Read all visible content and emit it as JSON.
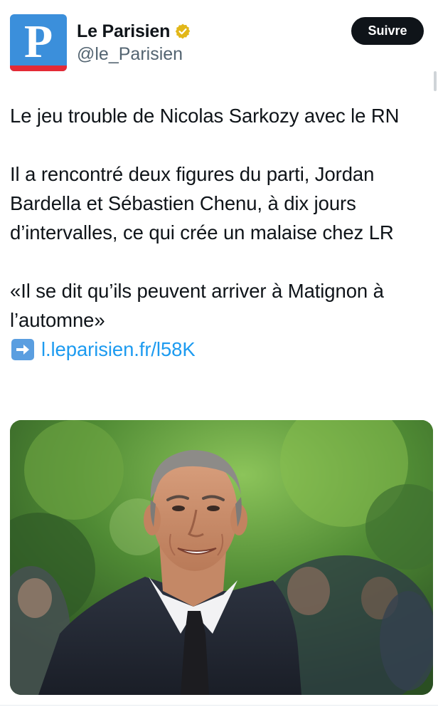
{
  "account": {
    "avatar_letter": "P",
    "display_name": "Le Parisien",
    "handle": "@le_Parisien",
    "verified_icon": "gold-verified-badge"
  },
  "actions": {
    "follow_label": "Suivre"
  },
  "tweet": {
    "headline_line": "Le jeu trouble de Nicolas Sarkozy avec le RN",
    "paragraph": "Il a rencontré deux figures du parti, Jordan Bardella et Sébastien Chenu, à dix jours d’intervalles, ce qui crée un malaise chez LR",
    "quote": "«Il se dit qu’ils peuvent arriver à Matignon à l’automne»",
    "link_icon": "right-arrow-emoji",
    "link_text": "l.leparisien.fr/l58K"
  },
  "media": {
    "type": "photo"
  },
  "colors": {
    "brand_blue": "#3b8fdb",
    "brand_red": "#e42a36",
    "link": "#1d9bf0",
    "verified_gold": "#e2b719"
  }
}
